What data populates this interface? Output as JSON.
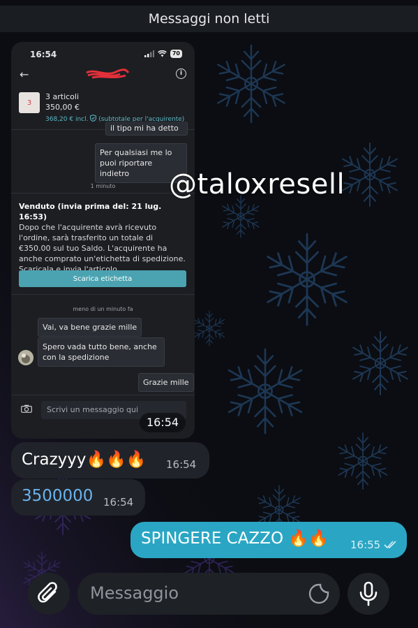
{
  "header": {
    "unread_label": "Messaggi non letti"
  },
  "screenshot": {
    "status_time": "16:54",
    "battery": "70",
    "order": {
      "thumb_count": "3",
      "items_label": "3 articoli",
      "price": "350,00 €",
      "incl_price": "368,20 € incl.",
      "subtotal_note": "(subtotale per l'acquirente)"
    },
    "messages": {
      "cut_off": "il tipo mi ha detto di si",
      "restore": "Per qualsiasi me lo puoi riportare indietro",
      "time_1": "1 minuto",
      "time_2": "meno di un minuto fa",
      "ok": "Vai, va bene grazie mille",
      "hope": "Spero vada tutto bene, anche con la spedizione",
      "thanks": "Grazie mille"
    },
    "sold": {
      "title": "Venduto (invia prima del: 21 lug. 16:53)",
      "body": "Dopo che l'acquirente avrà ricevuto l'ordine, sarà trasferito un totale di €350.00 sul tuo Saldo. L'acquirente ha anche comprato un'etichetta di spedizione. Scaricala e invia l'articolo.",
      "download_button": "Scarica etichetta"
    },
    "composer_placeholder": "Scrivi un messaggio qui",
    "photo_time": "16:54"
  },
  "watermark": "@taloxresell",
  "chat": [
    {
      "text": "Crazyyy🔥🔥🔥",
      "time": "16:54",
      "direction": "in"
    },
    {
      "text": "3500000",
      "time": "16:54",
      "direction": "in"
    },
    {
      "text": "SPINGERE CAZZO 🔥🔥",
      "time": "16:55",
      "direction": "out",
      "read": true
    }
  ],
  "input": {
    "placeholder": "Messaggio"
  },
  "icons": {
    "attach": "paperclip-icon",
    "mic": "microphone-icon",
    "sticker": "sticker-icon",
    "camera": "camera-icon",
    "info": "info-icon",
    "back": "back-arrow-icon",
    "shield": "shield-check-icon",
    "read": "double-check-icon"
  },
  "colors": {
    "outgoing_bubble": "#2aa6c4",
    "incoming_bubble": "#202329",
    "link": "#6ab4ee",
    "download_button": "#4ba3b1"
  }
}
